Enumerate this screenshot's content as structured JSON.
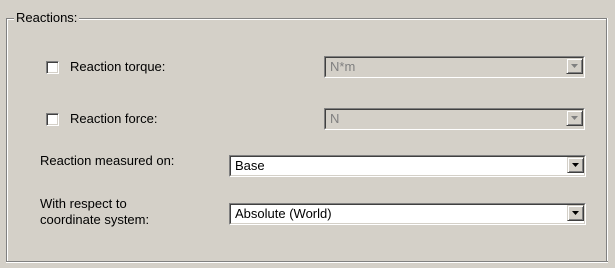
{
  "group": {
    "legend": "Reactions:"
  },
  "reaction_torque": {
    "label": "Reaction torque:",
    "checked": false,
    "unit_value": "N*m",
    "unit_enabled": false
  },
  "reaction_force": {
    "label": "Reaction force:",
    "checked": false,
    "unit_value": "N",
    "unit_enabled": false
  },
  "measured_on": {
    "label": "Reaction measured on:",
    "value": "Base"
  },
  "coordinate_system": {
    "label_line1": "With respect to",
    "label_line2": "coordinate system:",
    "value": "Absolute (World)"
  },
  "icons": {
    "dropdown": "chevron-down-icon",
    "checkbox": "checkbox-unchecked-icon"
  },
  "colors": {
    "face": "#d4d0c8",
    "shadow": "#808080",
    "highlight": "#ffffff",
    "disabled_text": "#808080"
  }
}
